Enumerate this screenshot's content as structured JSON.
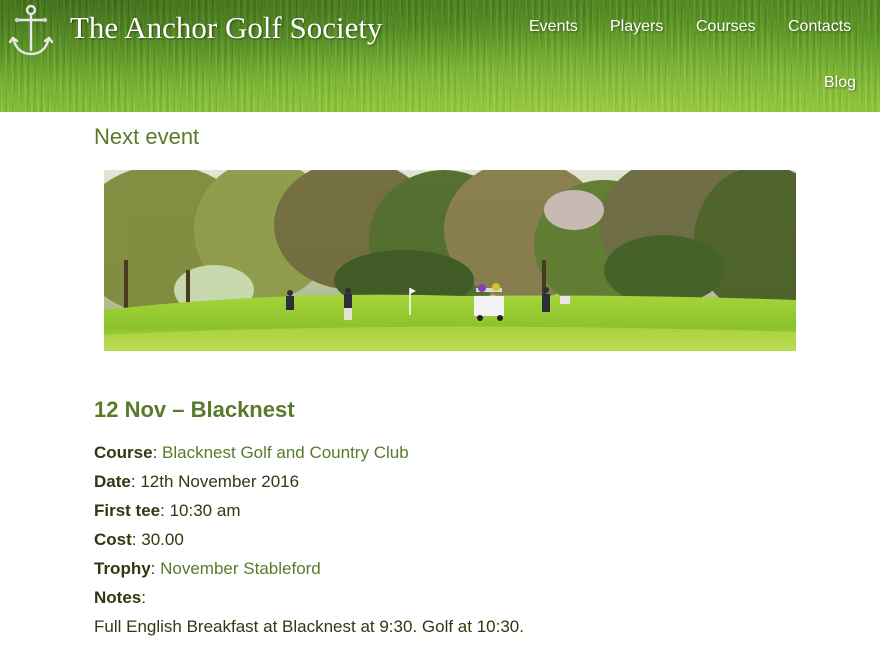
{
  "header": {
    "site_title": "The Anchor Golf Society",
    "nav": {
      "events": "Events",
      "players": "Players",
      "courses": "Courses",
      "contacts": "Contacts",
      "blog": "Blog"
    }
  },
  "main": {
    "section_title": "Next event",
    "event": {
      "heading": "12 Nov – Blacknest",
      "course_label": "Course",
      "course_value": "Blacknest Golf and Country Club",
      "date_label": "Date",
      "date_value": "12th November 2016",
      "first_tee_label": "First tee",
      "first_tee_value": "10:30 am",
      "cost_label": "Cost",
      "cost_value": "30.00",
      "trophy_label": "Trophy",
      "trophy_value": "November Stableford",
      "notes_label": "Notes",
      "notes_value": "Full English Breakfast at Blacknest at 9:30. Golf at 10:30."
    }
  },
  "colors": {
    "accent_green": "#5a7a2b",
    "body_text": "#2e3a12",
    "header_grass": "#5c9c22"
  },
  "icons": {
    "logo": "anchor-icon"
  }
}
